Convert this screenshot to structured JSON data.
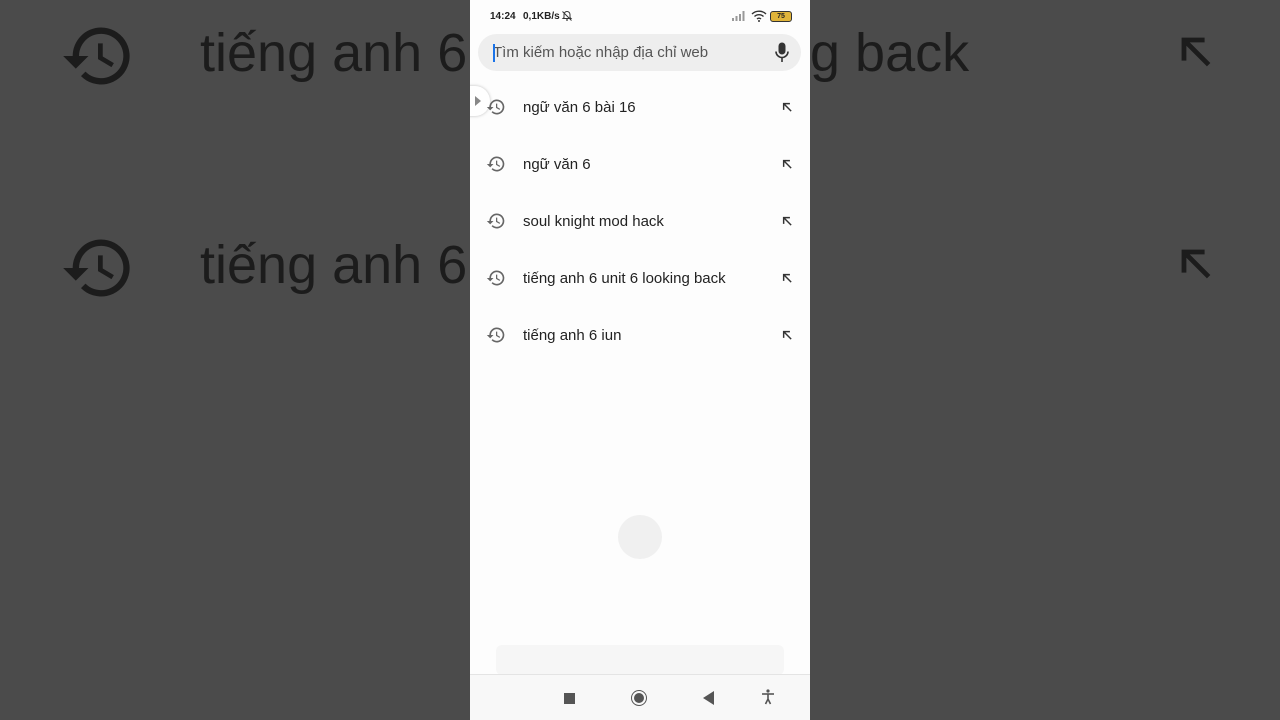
{
  "background": {
    "row1_text": "tiếng anh 6",
    "row1_right": "g back",
    "row2_text": "tiếng anh 6"
  },
  "status_bar": {
    "time": "14:24",
    "speed": "0,1KB/s",
    "battery": "75"
  },
  "search": {
    "placeholder": "Tìm kiếm hoặc nhập địa chỉ web",
    "value": ""
  },
  "suggestions": [
    {
      "text": "ngữ văn 6 bài 16"
    },
    {
      "text": "ngữ văn 6"
    },
    {
      "text": "soul knight mod hack"
    },
    {
      "text": "tiếng anh 6 unit 6 looking back"
    },
    {
      "text": "tiếng anh 6 iun"
    }
  ],
  "icons": {
    "history": "history-icon",
    "fill_arrow": "arrow-up-left-icon",
    "mic": "mic-icon"
  },
  "colors": {
    "accent": "#1a73e8",
    "letterbox": "#4b4b4b",
    "search_bg": "#eeeeee"
  }
}
